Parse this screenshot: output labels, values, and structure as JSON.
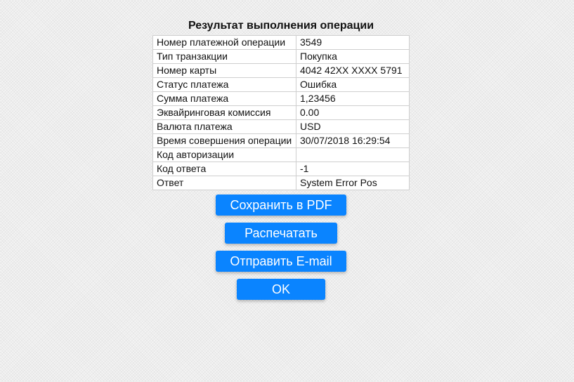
{
  "page": {
    "title": "Результат выполнения операции"
  },
  "details": {
    "rows": [
      {
        "label": "Номер платежной операции",
        "value": "3549"
      },
      {
        "label": "Тип транзакции",
        "value": "Покупка"
      },
      {
        "label": "Номер карты",
        "value": "4042 42XX XXXX 5791"
      },
      {
        "label": "Статус платежа",
        "value": "Ошибка"
      },
      {
        "label": "Сумма платежа",
        "value": "1,23456"
      },
      {
        "label": "Эквайринговая комиссия",
        "value": "0.00"
      },
      {
        "label": "Валюта платежа",
        "value": "USD"
      },
      {
        "label": "Время совершения операции",
        "value": "30/07/2018 16:29:54"
      },
      {
        "label": "Код авторизации",
        "value": ""
      },
      {
        "label": "Код ответа",
        "value": "-1"
      },
      {
        "label": "Ответ",
        "value": "System Error Pos"
      }
    ]
  },
  "actions": {
    "save_pdf_label": "Сохранить в PDF",
    "print_label": "Распечатать",
    "email_label": "Отправить E-mail",
    "ok_label": "OK"
  },
  "colors": {
    "button_background": "#0a84ff",
    "button_text": "#ffffff",
    "page_background": "#f4f4f4"
  }
}
